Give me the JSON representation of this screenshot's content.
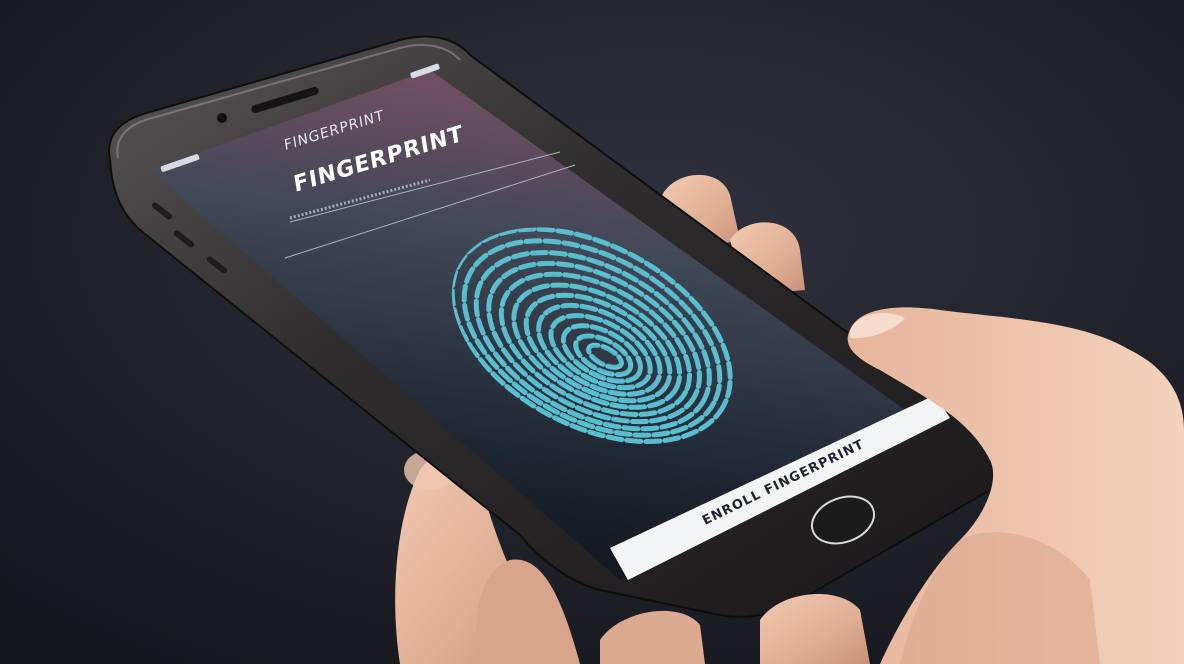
{
  "screen": {
    "header_small": "FINGERPRINT",
    "header_large": "FINGERPRINT",
    "bottom_button_label": "ENROLL FINGERPRINT"
  },
  "colors": {
    "background": "#1c1e27",
    "phone_body": "#2d2b2c",
    "screen_top": "#6b4a5a",
    "screen_bottom": "#15181e",
    "fingerprint": "#4aa7c0",
    "bottom_bar": "#f3f4f6",
    "skin": "#e9bfa6"
  },
  "icons": {
    "fingerprint": "fingerprint-icon",
    "home_button": "home-button-ring"
  }
}
